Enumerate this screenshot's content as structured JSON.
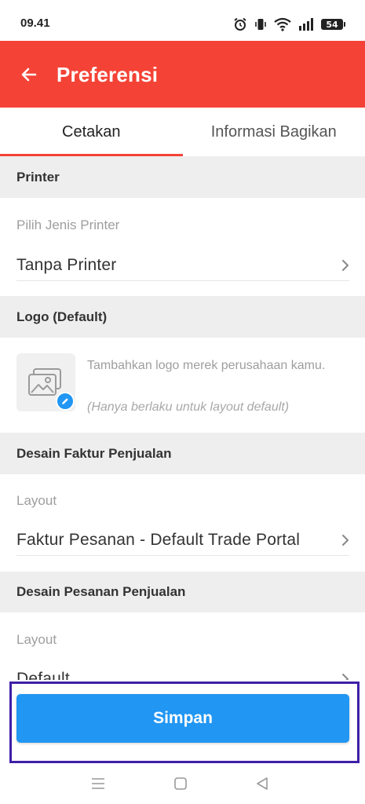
{
  "status_bar": {
    "time": "09.41",
    "battery": "54",
    "icons": [
      "alarm-icon",
      "vibrate-icon",
      "wifi-icon",
      "signal-icon",
      "battery-icon"
    ]
  },
  "app_bar": {
    "title": "Preferensi",
    "back_icon": "arrow-left-icon",
    "background": "#f44336"
  },
  "tabs": {
    "items": [
      {
        "label": "Cetakan",
        "active": true
      },
      {
        "label": "Informasi Bagikan",
        "active": false
      }
    ],
    "indicator_color": "#f44336"
  },
  "sections": {
    "printer": {
      "header": "Printer",
      "field_label": "Pilih Jenis Printer",
      "value": "Tanpa Printer"
    },
    "logo": {
      "header": "Logo (Default)",
      "description": "Tambahkan logo merek perusahaan kamu.",
      "note": "(Hanya berlaku untuk layout default)"
    },
    "invoice_design": {
      "header": "Desain Faktur Penjualan",
      "field_label": "Layout",
      "value": "Faktur Pesanan - Default Trade Portal"
    },
    "order_design": {
      "header": "Desain Pesanan Penjualan",
      "field_label": "Layout",
      "value": "Default"
    }
  },
  "save_button": {
    "label": "Simpan",
    "color": "#2196f3"
  },
  "nav_bar": {
    "icons": [
      "menu-icon",
      "home-square-icon",
      "back-triangle-icon"
    ]
  }
}
